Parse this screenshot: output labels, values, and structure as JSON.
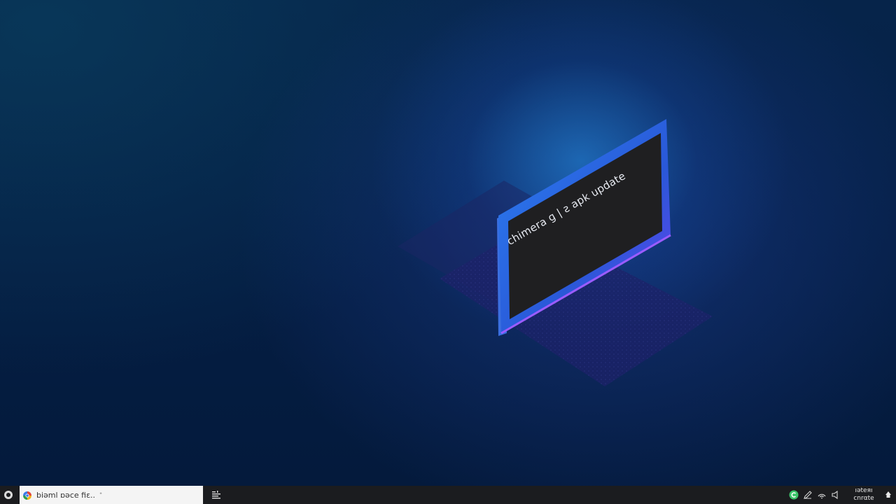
{
  "wallpaper": {
    "monitor_caption": "chimera ɡ | ƨ apk update",
    "colors": {
      "background": "#051f45",
      "glow": "#2a96f0",
      "monitor_frame": "#2f6fd8",
      "monitor_edge": "#8a4dff",
      "screen": "#1f1f21"
    }
  },
  "taskbar": {
    "search": {
      "text": "biəml ɒəce fiɛ..",
      "cursor": "ᐩ",
      "icon": "browser-logo-icon"
    },
    "clock": {
      "line1": "ıəteяı",
      "line2": "cnrαte"
    },
    "tray_icons": [
      "green-app-icon",
      "pen-icon",
      "network-icon",
      "speaker-icon"
    ],
    "colors": {
      "bar": "#1b1c1f",
      "search_bg": "#f4f4f4",
      "tray_green": "#3cc46a"
    }
  }
}
